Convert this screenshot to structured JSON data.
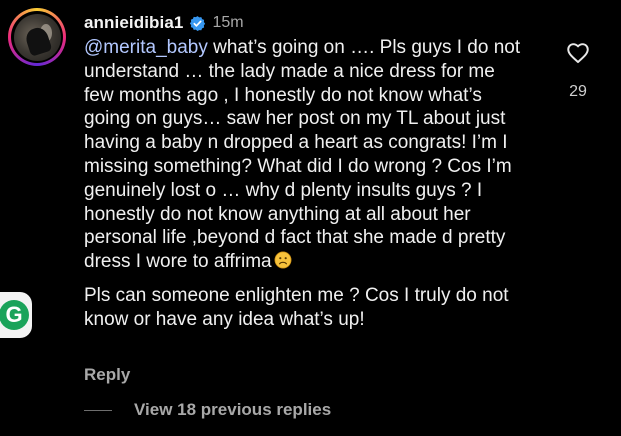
{
  "comment": {
    "username": "annieidibia1",
    "timestamp": "15m",
    "mention": "@merita_baby",
    "paragraph1_rest": " what’s going on …. Pls guys I do not understand … the lady made a nice dress for me few months ago , I honestly do not know what’s going on guys… saw her post on my TL about just having a baby n dropped a heart as congrats!  I’m I missing something? What did I do wrong ? Cos I’m genuinely lost o … why d plenty insults guys ? I honestly do not know anything at all about her personal life ,beyond d fact that she made d pretty dress I wore to affrima",
    "paragraph2": "Pls can someone enlighten me ? Cos I truly do not know or have any idea what’s up!",
    "like_count": "29",
    "reply_label": "Reply",
    "view_replies_label": "View 18 previous replies"
  },
  "icons": {
    "verified": "verified-badge-icon",
    "like": "heart-outline-icon",
    "emoji": "frowning-face-emoji",
    "side_logo": "green-g-logo-icon"
  },
  "colors": {
    "background": "#000000",
    "text": "#f0f0f0",
    "secondary_text": "#a8a8a8",
    "verified_blue": "#3797f0",
    "mention": "#b3c8ff"
  }
}
